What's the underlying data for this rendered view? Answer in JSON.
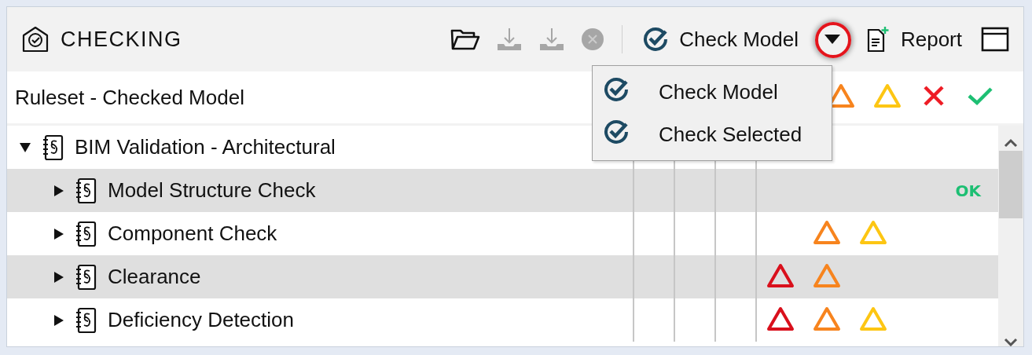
{
  "toolbar": {
    "title": "CHECKING",
    "tools": [
      {
        "kind": "open",
        "disabled": false
      },
      {
        "kind": "download",
        "disabled": true
      },
      {
        "kind": "download",
        "disabled": true
      },
      {
        "kind": "stop",
        "disabled": true
      }
    ],
    "check_button": {
      "label": "Check Model",
      "dropdown_highlighted": true
    },
    "report_button": {
      "label": "Report"
    }
  },
  "dropdown_menu": [
    {
      "label": "Check Model"
    },
    {
      "label": "Check Selected"
    }
  ],
  "header": {
    "title": "Ruleset - Checked Model",
    "columns": [
      {
        "kind": "major",
        "color": "#f7841e"
      },
      {
        "kind": "minor",
        "color": "#fdc613"
      },
      {
        "kind": "failed",
        "color": "#ee1c25"
      },
      {
        "kind": "passed",
        "color": "#1dbf73"
      }
    ]
  },
  "tree": [
    {
      "label": "BIM Validation - Architectural",
      "expanded": true,
      "children": [
        {
          "label": "Model Structure Check",
          "expanded": false,
          "status": "OK"
        },
        {
          "label": "Component Check",
          "expanded": false,
          "issues": [
            {
              "kind": "major",
              "color": "#f7841e"
            },
            {
              "kind": "minor",
              "color": "#fdc613"
            }
          ]
        },
        {
          "label": "Clearance",
          "expanded": false,
          "issues": [
            {
              "kind": "critical",
              "color": "#d9101c"
            },
            {
              "kind": "major",
              "color": "#f7841e"
            }
          ]
        },
        {
          "label": "Deficiency Detection",
          "expanded": false,
          "issues": [
            {
              "kind": "critical",
              "color": "#d9101c"
            },
            {
              "kind": "major",
              "color": "#f7841e"
            },
            {
              "kind": "minor",
              "color": "#fdc613"
            }
          ]
        }
      ]
    }
  ]
}
